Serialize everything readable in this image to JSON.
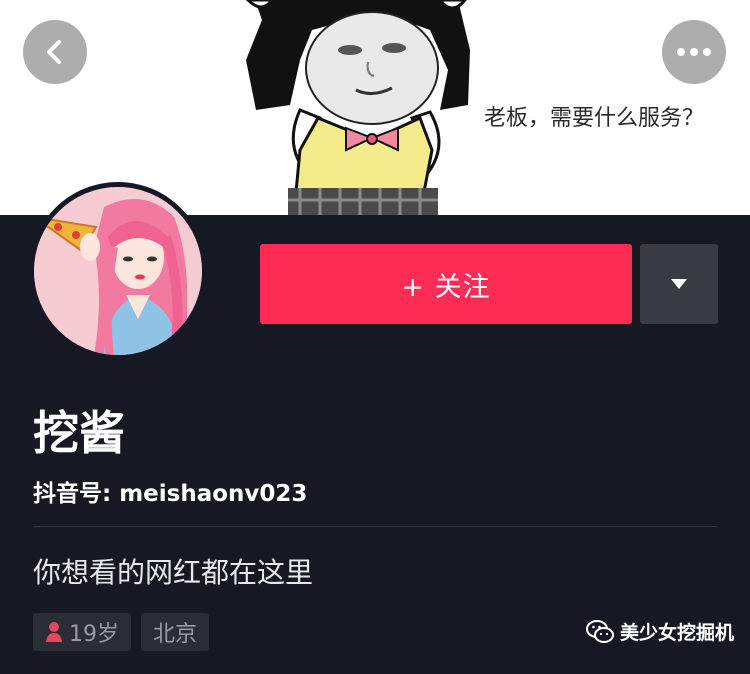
{
  "cover": {
    "caption": "老板，需要什么服务？",
    "back_icon": "chevron-left-icon",
    "more_icon": "more-dots-icon"
  },
  "profile": {
    "follow_label": "+ 关注",
    "dropdown_icon": "caret-down-icon",
    "nickname": "挖酱",
    "douyin_id": "抖音号: meishaonv023",
    "bio": "你想看的网红都在这里",
    "tags": {
      "age": "19岁",
      "age_icon": "female-user-icon",
      "city": "北京"
    }
  },
  "watermark": {
    "text": "美少女挖掘机",
    "icon": "wechat-icon"
  },
  "colors": {
    "background": "#161823",
    "follow_button": "#fe2c55",
    "dropdown_button": "#393b44",
    "tag_background": "#2a2c36",
    "female_icon": "#e8465f"
  }
}
